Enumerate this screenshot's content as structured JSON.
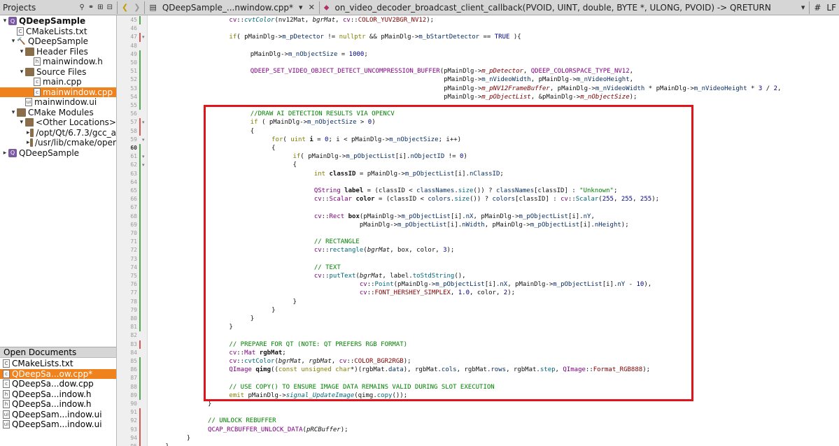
{
  "top_bar": {
    "projects_label": "Projects",
    "file_tab": "QDeepSample_...nwindow.cpp*",
    "function_symbol": "on_video_decoder_broadcast_client_callback(PVOID, UINT, double, BYTE *, ULONG, PVOID) -> QRETURN",
    "hash": "#",
    "line_ending": "LF"
  },
  "project_tree": [
    {
      "label": "QDeepSample",
      "bold": true,
      "depth": 0,
      "icon": "project-icon",
      "arrow": "▾"
    },
    {
      "label": "CMakeLists.txt",
      "depth": 1,
      "icon": "cmake-file-icon",
      "arrow": ""
    },
    {
      "label": "QDeepSample",
      "depth": 1,
      "icon": "build-target-icon",
      "arrow": "▾"
    },
    {
      "label": "Header Files",
      "depth": 2,
      "icon": "folder-icon",
      "arrow": "▾"
    },
    {
      "label": "mainwindow.h",
      "depth": 3,
      "icon": "header-file-icon",
      "arrow": ""
    },
    {
      "label": "Source Files",
      "depth": 2,
      "icon": "folder-icon",
      "arrow": "▾"
    },
    {
      "label": "main.cpp",
      "depth": 3,
      "icon": "cpp-file-icon",
      "arrow": ""
    },
    {
      "label": "mainwindow.cpp",
      "depth": 3,
      "icon": "cpp-file-icon",
      "arrow": "",
      "selected": true
    },
    {
      "label": "mainwindow.ui",
      "depth": 2,
      "icon": "ui-file-icon",
      "arrow": ""
    },
    {
      "label": "CMake Modules",
      "depth": 1,
      "icon": "cmake-modules-icon",
      "arrow": "▾"
    },
    {
      "label": "<Other Locations>",
      "depth": 2,
      "icon": "folder-icon",
      "arrow": "▾"
    },
    {
      "label": "/opt/Qt/6.7.3/gcc_a",
      "depth": 3,
      "icon": "folder-icon",
      "arrow": "▸"
    },
    {
      "label": "/usr/lib/cmake/oper",
      "depth": 3,
      "icon": "folder-icon",
      "arrow": "▸"
    },
    {
      "label": "QDeepSample",
      "depth": 0,
      "icon": "project-icon",
      "arrow": "▸"
    }
  ],
  "open_documents": {
    "header": "Open Documents",
    "items": [
      {
        "label": "CMakeLists.txt",
        "icon": "cmake-file-icon"
      },
      {
        "label": "QDeepSa...ow.cpp*",
        "icon": "cpp-file-icon",
        "selected": true
      },
      {
        "label": "QDeepSa...dow.cpp",
        "icon": "cpp-file-icon"
      },
      {
        "label": "QDeepSa...indow.h",
        "icon": "header-file-icon"
      },
      {
        "label": "QDeepSa...indow.h",
        "icon": "header-file-icon"
      },
      {
        "label": "QDeepSam...indow.ui",
        "icon": "ui-file-icon"
      },
      {
        "label": "QDeepSam...indow.ui",
        "icon": "ui-file-icon"
      }
    ]
  },
  "editor": {
    "current_line": "60",
    "lines": [
      {
        "num": "45",
        "indent": 4,
        "html": "<span class='t'>cv</span>::<span class='f i'>cvtColor</span>(nv12Mat, <span class='i'>bgrMat</span>, <span class='t'>cv</span>::<span class='m'>COLOR_YUV2BGR_NV12</span>);"
      },
      {
        "num": "46",
        "indent": 4,
        "html": ""
      },
      {
        "num": "47",
        "indent": 4,
        "html": "<span class='k'>if</span>( pMainDlg-><span class='v'>m_pDetector</span> != <span class='k'>nullptr</span> && pMainDlg-><span class='v'>m_bStartDetector</span> == <span class='n'>TRUE</span> ){"
      },
      {
        "num": "48",
        "indent": 4,
        "html": ""
      },
      {
        "num": "49",
        "indent": 5,
        "html": "pMainDlg-><span class='v'>m_nObjectSize</span> = <span class='n'>1000</span>;"
      },
      {
        "num": "50",
        "indent": 5,
        "html": ""
      },
      {
        "num": "51",
        "indent": 5,
        "html": "<span class='t'>QDEEP_SET_VIDEO_OBJECT_DETECT_UNCOMPRESSION_BUFFER</span>(pMainDlg-><span class='m i'>m_pDetector</span>, <span class='t'>QDEEP_COLORSPACE_TYPE_NV12</span>,"
      },
      {
        "num": "52",
        "indent": 5,
        "html": "                                                   pMainDlg-><span class='v'>m_nVideoWidth</span>, pMainDlg-><span class='v'>m_nVideoHeight</span>,"
      },
      {
        "num": "53",
        "indent": 5,
        "html": "                                                   pMainDlg-><span class='m i'>m_pNV12FrameBuffer</span>, pMainDlg-><span class='v'>m_nVideoWidth</span> * pMainDlg-><span class='v'>m_nVideoHeight</span> * <span class='n'>3</span> / <span class='n'>2</span>,"
      },
      {
        "num": "54",
        "indent": 5,
        "html": "                                                   pMainDlg-><span class='m i'>m_pObjectList</span>, &pMainDlg-><span class='m i'>m_nObjectSize</span>);"
      },
      {
        "num": "55",
        "indent": 5,
        "html": ""
      },
      {
        "num": "56",
        "indent": 5,
        "html": "<span class='c'>//DRAW AI DETECTION RESULTS VIA OPENCV</span>"
      },
      {
        "num": "57",
        "indent": 5,
        "html": "<span class='k'>if</span> ( pMainDlg-><span class='v'>m_nObjectSize</span> > <span class='n'>0</span>)"
      },
      {
        "num": "58",
        "indent": 5,
        "html": "{"
      },
      {
        "num": "59",
        "indent": 6,
        "html": "<span class='k'>for</span>( <span class='k'>uint</span> <span class='b'>i</span> = <span class='n'>0</span>; i < pMainDlg-><span class='v'>m_nObjectSize</span>; i++)"
      },
      {
        "num": "60",
        "indent": 6,
        "html": "{"
      },
      {
        "num": "61",
        "indent": 7,
        "html": "<span class='k'>if</span>( pMainDlg-><span class='v'>m_pObjectList</span>[i].<span class='v'>nObjectID</span> != <span class='n'>0</span>)"
      },
      {
        "num": "62",
        "indent": 7,
        "html": "{"
      },
      {
        "num": "63",
        "indent": 8,
        "html": "<span class='k'>int</span> <span class='b'>classID</span> = pMainDlg-><span class='v'>m_pObjectList</span>[i].<span class='v'>nClassID</span>;"
      },
      {
        "num": "64",
        "indent": 8,
        "html": ""
      },
      {
        "num": "65",
        "indent": 8,
        "html": "<span class='t'>QString</span> <span class='b'>label</span> = (classID < <span class='v'>classNames</span>.<span class='f'>size</span>()) ? <span class='v'>classNames</span>[classID] : <span class='s'>\"Unknown\"</span>;"
      },
      {
        "num": "66",
        "indent": 8,
        "html": "<span class='t'>cv</span>::<span class='t'>Scalar</span> <span class='b'>color</span> = (classID < <span class='v'>colors</span>.<span class='f'>size</span>()) ? <span class='v'>colors</span>[classID] : <span class='t'>cv</span>::<span class='f'>Scalar</span>(<span class='n'>255</span>, <span class='n'>255</span>, <span class='n'>255</span>);"
      },
      {
        "num": "67",
        "indent": 8,
        "html": ""
      },
      {
        "num": "68",
        "indent": 8,
        "html": "<span class='t'>cv</span>::<span class='t'>Rect</span> <span class='b'>box</span>(pMainDlg-><span class='v'>m_pObjectList</span>[i].<span class='v'>nX</span>, pMainDlg-><span class='v'>m_pObjectList</span>[i].<span class='v'>nY</span>,"
      },
      {
        "num": "69",
        "indent": 8,
        "html": "            pMainDlg-><span class='v'>m_pObjectList</span>[i].<span class='v'>nWidth</span>, pMainDlg-><span class='v'>m_pObjectList</span>[i].<span class='v'>nHeight</span>);"
      },
      {
        "num": "70",
        "indent": 8,
        "html": ""
      },
      {
        "num": "71",
        "indent": 8,
        "html": "<span class='c'>// RECTANGLE</span>"
      },
      {
        "num": "72",
        "indent": 8,
        "html": "<span class='t'>cv</span>::<span class='f'>rectangle</span>(<span class='i'>bgrMat</span>, box, color, <span class='n'>3</span>);"
      },
      {
        "num": "73",
        "indent": 8,
        "html": ""
      },
      {
        "num": "74",
        "indent": 8,
        "html": "<span class='c'>// TEXT</span>"
      },
      {
        "num": "75",
        "indent": 8,
        "html": "<span class='t'>cv</span>::<span class='f'>putText</span>(<span class='i'>bgrMat</span>, label.<span class='f'>toStdString</span>(),"
      },
      {
        "num": "76",
        "indent": 8,
        "html": "            <span class='t'>cv</span>::<span class='f'>Point</span>(pMainDlg-><span class='v'>m_pObjectList</span>[i].<span class='v'>nX</span>, pMainDlg-><span class='v'>m_pObjectList</span>[i].<span class='v'>nY</span> - <span class='n'>10</span>),"
      },
      {
        "num": "77",
        "indent": 8,
        "html": "            <span class='t'>cv</span>::<span class='m'>FONT_HERSHEY_SIMPLEX</span>, <span class='n'>1.0</span>, color, <span class='n'>2</span>);"
      },
      {
        "num": "78",
        "indent": 7,
        "html": "}"
      },
      {
        "num": "79",
        "indent": 6,
        "html": "}"
      },
      {
        "num": "80",
        "indent": 5,
        "html": "}"
      },
      {
        "num": "81",
        "indent": 4,
        "html": "}"
      },
      {
        "num": "82",
        "indent": 4,
        "html": ""
      },
      {
        "num": "83",
        "indent": 4,
        "html": "<span class='c'>// PREPARE FOR QT (NOTE: QT PREFERS RGB FORMAT)</span>"
      },
      {
        "num": "84",
        "indent": 4,
        "html": "<span class='t'>cv</span>::<span class='t'>Mat</span> <span class='b'>rgbMat</span>;"
      },
      {
        "num": "85",
        "indent": 4,
        "html": "<span class='t'>cv</span>::<span class='f'>cvtColor</span>(<span class='i'>bgrMat</span>, <span class='i'>rgbMat</span>, <span class='t'>cv</span>::<span class='m'>COLOR_BGR2RGB</span>);"
      },
      {
        "num": "86",
        "indent": 4,
        "html": "<span class='t'>QImage</span> <span class='b'>qimg</span>((<span class='k'>const</span> <span class='k'>unsigned</span> <span class='k'>char</span>*)(rgbMat.<span class='v'>data</span>), rgbMat.<span class='v'>cols</span>, rgbMat.<span class='v'>rows</span>, rgbMat.<span class='f'>step</span>, <span class='t'>QImage</span>::<span class='m'>Format_RGB888</span>);"
      },
      {
        "num": "87",
        "indent": 4,
        "html": ""
      },
      {
        "num": "88",
        "indent": 4,
        "html": "<span class='c'>// USE COPY() TO ENSURE IMAGE DATA REMAINS VALID DURING SLOT EXECUTION</span>"
      },
      {
        "num": "89",
        "indent": 4,
        "html": "<span class='k'>emit</span> pMainDlg-><span class='f i'>signal_UpdateImage</span>(qimg.<span class='f'>copy</span>());"
      },
      {
        "num": "90",
        "indent": 3,
        "html": "}"
      },
      {
        "num": "91",
        "indent": 3,
        "html": ""
      },
      {
        "num": "92",
        "indent": 3,
        "html": "<span class='c'>// UNLOCK REBUFFER</span>"
      },
      {
        "num": "93",
        "indent": 3,
        "html": "<span class='t'>QCAP_RCBUFFER_UNLOCK_DATA</span>(<span class='i'>pRCBuffer</span>);"
      },
      {
        "num": "94",
        "indent": 2,
        "html": "}"
      },
      {
        "num": "95",
        "indent": 1,
        "html": "}"
      }
    ]
  }
}
